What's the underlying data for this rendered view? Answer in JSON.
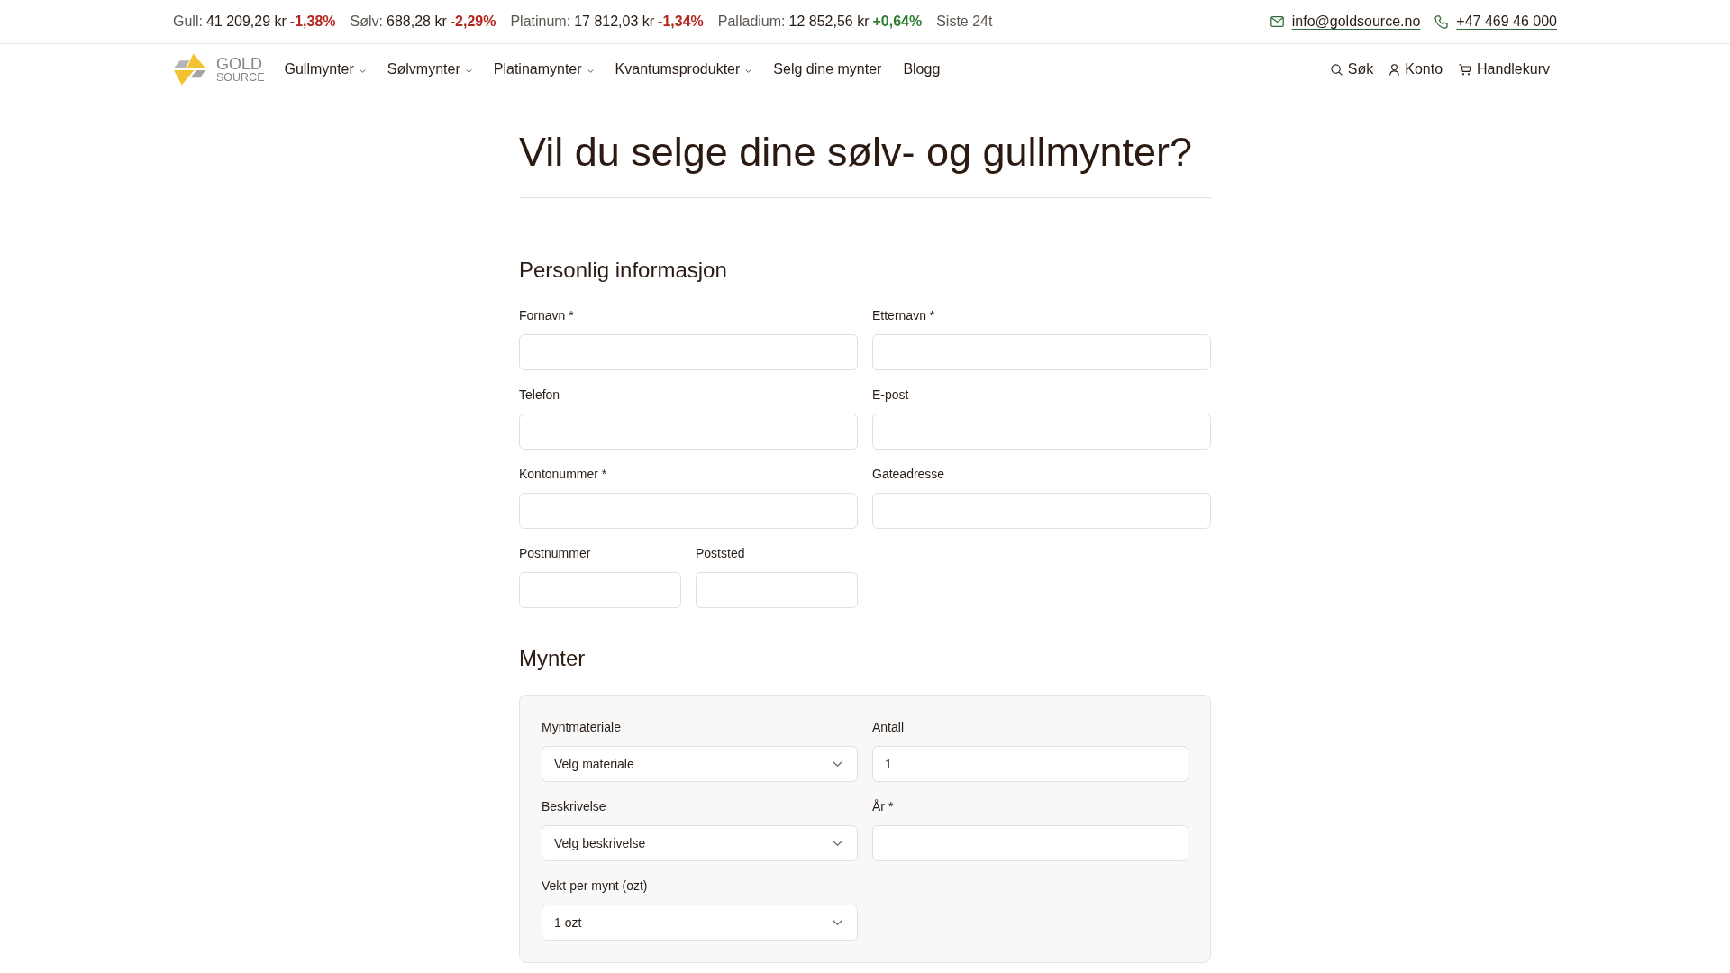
{
  "ticker": {
    "items": [
      {
        "label": "Gull:",
        "price": "41 209,29 kr",
        "change": "-1,38%",
        "color": "#b3261e"
      },
      {
        "label": "Sølv:",
        "price": "688,28 kr",
        "change": "-2,29%",
        "color": "#b3261e"
      },
      {
        "label": "Platinum:",
        "price": "17 812,03 kr",
        "change": "-1,34%",
        "color": "#b3261e"
      },
      {
        "label": "Palladium:",
        "price": "12 852,56 kr",
        "change": "+0,64%",
        "color": "#2e7d32"
      }
    ],
    "period": "Siste 24t"
  },
  "contact": {
    "email": "info@goldsource.no",
    "phone": "+47 469 46 000"
  },
  "nav": {
    "logo": {
      "line_1": "GOLD",
      "line_2": "SOURCE"
    },
    "menu": [
      {
        "label": "Gullmynter",
        "has_dropdown": true
      },
      {
        "label": "Sølvmynter",
        "has_dropdown": true
      },
      {
        "label": "Platinamynter",
        "has_dropdown": true
      },
      {
        "label": "Kvantumsprodukter",
        "has_dropdown": true
      },
      {
        "label": "Selg dine mynter",
        "has_dropdown": false
      },
      {
        "label": "Blogg",
        "has_dropdown": false
      }
    ],
    "actions": [
      {
        "label": "Søk",
        "kind": "search"
      },
      {
        "label": "Konto",
        "kind": "account"
      },
      {
        "label": "Handlekurv",
        "kind": "cart"
      }
    ]
  },
  "page_title": "Vil du selge dine sølv- og gullmynter?",
  "sections": [
    {
      "heading": "Personlig informasjon",
      "kind": "plain",
      "fields": [
        {
          "label": "Fornavn *",
          "kind": "text"
        },
        {
          "label": "Etternavn *",
          "kind": "text"
        },
        {
          "label": "Telefon",
          "kind": "text"
        },
        {
          "label": "E-post",
          "kind": "text"
        },
        {
          "label": "Kontonummer *",
          "kind": "text"
        },
        {
          "label": "Gateadresse",
          "kind": "text"
        },
        {
          "label": "Postnummer",
          "kind": "short"
        },
        {
          "label": "Poststed",
          "kind": "short"
        }
      ]
    },
    {
      "heading": "Mynter",
      "kind": "panel",
      "fields": [
        {
          "label": "Myntmateriale",
          "kind": "select",
          "value": "Velg materiale"
        },
        {
          "label": "Antall",
          "kind": "text",
          "value": "1"
        },
        {
          "label": "Beskrivelse",
          "kind": "select",
          "value": "Velg beskrivelse"
        },
        {
          "label": "År *",
          "kind": "text"
        },
        {
          "label": "Vekt per mynt (ozt)",
          "kind": "select",
          "value": "1 ozt"
        }
      ]
    }
  ]
}
